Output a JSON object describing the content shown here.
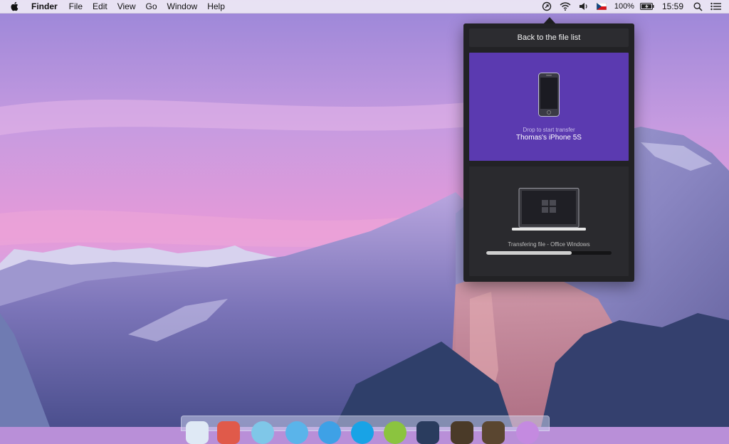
{
  "menubar": {
    "app_name": "Finder",
    "menus": [
      "File",
      "Edit",
      "View",
      "Go",
      "Window",
      "Help"
    ],
    "status": {
      "battery_percent": "100%",
      "clock": "15:59"
    },
    "icons": [
      "apple-icon",
      "airdrop-status-icon",
      "wifi-icon",
      "volume-icon",
      "czech-flag-icon",
      "battery-icon",
      "spotlight-search-icon",
      "notification-center-icon"
    ]
  },
  "popover": {
    "back_label": "Back to the file list",
    "target": {
      "hint": "Drop to start transfer",
      "device_name": "Thomas's iPhone 5S"
    },
    "transfer": {
      "status": "Transfering file - Office Windows",
      "progress": 0.68
    }
  },
  "dock": {
    "icon_count": 11
  },
  "colors": {
    "popover_bg": "#222225",
    "target_card": "#5b3ab0",
    "transfer_card": "#2a2a2e",
    "progress_fill": "#cfcfcf"
  }
}
